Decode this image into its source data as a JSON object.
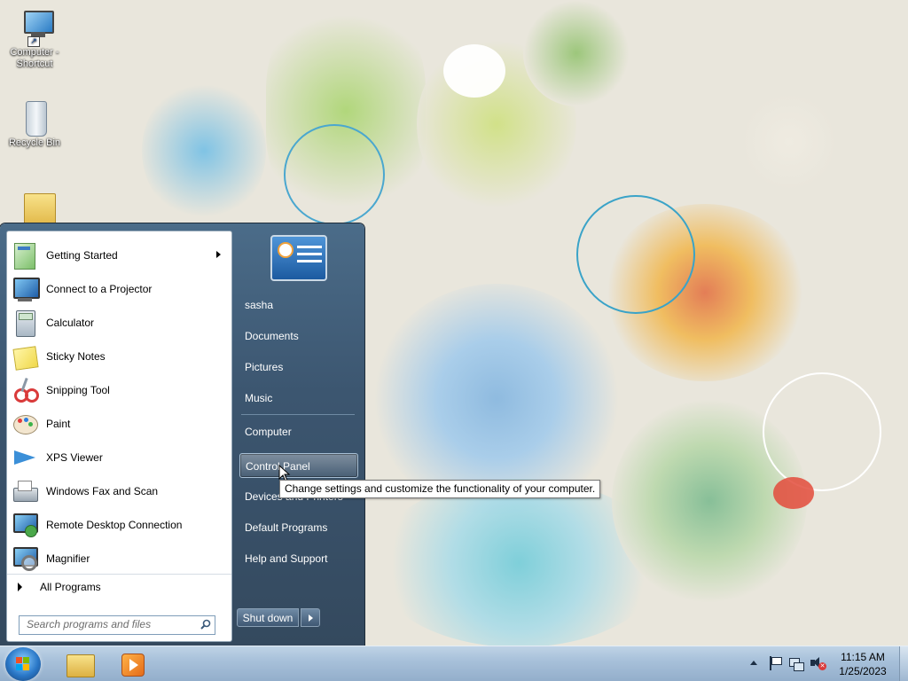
{
  "desktop": {
    "icons": [
      {
        "label": "Computer - Shortcut"
      },
      {
        "label": "Recycle Bin"
      },
      {
        "label": ""
      }
    ]
  },
  "start_menu": {
    "programs": [
      {
        "label": "Getting Started",
        "icon": "getting-started-icon",
        "has_submenu": true
      },
      {
        "label": "Connect to a Projector",
        "icon": "projector-icon"
      },
      {
        "label": "Calculator",
        "icon": "calculator-icon"
      },
      {
        "label": "Sticky Notes",
        "icon": "sticky-notes-icon"
      },
      {
        "label": "Snipping Tool",
        "icon": "scissors-icon"
      },
      {
        "label": "Paint",
        "icon": "paint-palette-icon"
      },
      {
        "label": "XPS Viewer",
        "icon": "xps-viewer-icon"
      },
      {
        "label": "Windows Fax and Scan",
        "icon": "fax-icon"
      },
      {
        "label": "Remote Desktop Connection",
        "icon": "remote-desktop-icon"
      },
      {
        "label": "Magnifier",
        "icon": "magnifier-icon"
      }
    ],
    "all_programs": "All Programs",
    "search_placeholder": "Search programs and files",
    "right_items": [
      {
        "label": "sasha"
      },
      {
        "label": "Documents"
      },
      {
        "label": "Pictures"
      },
      {
        "label": "Music"
      },
      {
        "label": "Computer"
      },
      {
        "label": "Control Panel",
        "highlighted": true
      },
      {
        "label": "Devices and Printers"
      },
      {
        "label": "Default Programs"
      },
      {
        "label": "Help and Support"
      }
    ],
    "shutdown_label": "Shut down",
    "tooltip": "Change settings and customize the functionality of your computer."
  },
  "taskbar": {
    "pinned": [
      {
        "icon": "windows-explorer-icon"
      },
      {
        "icon": "media-player-icon"
      }
    ],
    "tray": {
      "time": "11:15 AM",
      "date": "1/25/2023"
    }
  },
  "colors": {
    "start_menu_bg": "#3c5670",
    "taskbar_bg": "#a8c1da",
    "desktop_bg": "#e9e6dc"
  }
}
